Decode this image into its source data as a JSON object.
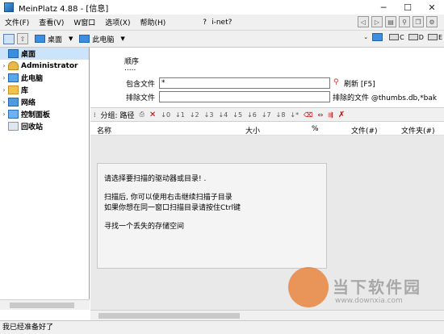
{
  "window": {
    "title": "MeinPlatz 4.88 - [信息]"
  },
  "menu": [
    "文件(F)",
    "查看(V)",
    "W窗口",
    "选项(X)",
    "帮助(H)"
  ],
  "menu_right": {
    "help_q": "?",
    "inet": "i-net?"
  },
  "pathbar": {
    "crumb1": "桌面",
    "crumb2": "此电脑",
    "drives": [
      "C",
      "D",
      "E"
    ]
  },
  "tree": [
    {
      "label": "桌面",
      "selected": true,
      "expander": ""
    },
    {
      "label": "Administrator",
      "expander": "›"
    },
    {
      "label": "此电脑",
      "expander": "›"
    },
    {
      "label": "库",
      "expander": "›"
    },
    {
      "label": "网络",
      "expander": "›"
    },
    {
      "label": "控制面板",
      "expander": "›"
    },
    {
      "label": "回收站",
      "expander": ""
    }
  ],
  "filter": {
    "order_label": "顺序",
    "order_value": ".....",
    "include_label": "包含文件",
    "include_value": "*",
    "exclude_label": "排除文件",
    "exclude_value": "",
    "refresh_label": "刷新 [F5]",
    "excluded_files_label": "排除的文件 @thumbs.db,*bak"
  },
  "toolbar2": {
    "group_label": "分组: 路径"
  },
  "list": {
    "columns": [
      "名称",
      "大小",
      "%",
      "文件(#)",
      "文件夹(#)"
    ]
  },
  "message": {
    "line1": "请选择要扫描的驱动器或目录! .",
    "line2": "扫描后, 你可以使用右击继续扫描子目录",
    "line3": "如果你想在同一窗口扫描目录请按住Ctrl键",
    "line4": "寻找一个丢失的存储空间"
  },
  "status": "我已经准备好了",
  "watermark": {
    "text": "当下软件园",
    "url": "www.downxia.com"
  }
}
